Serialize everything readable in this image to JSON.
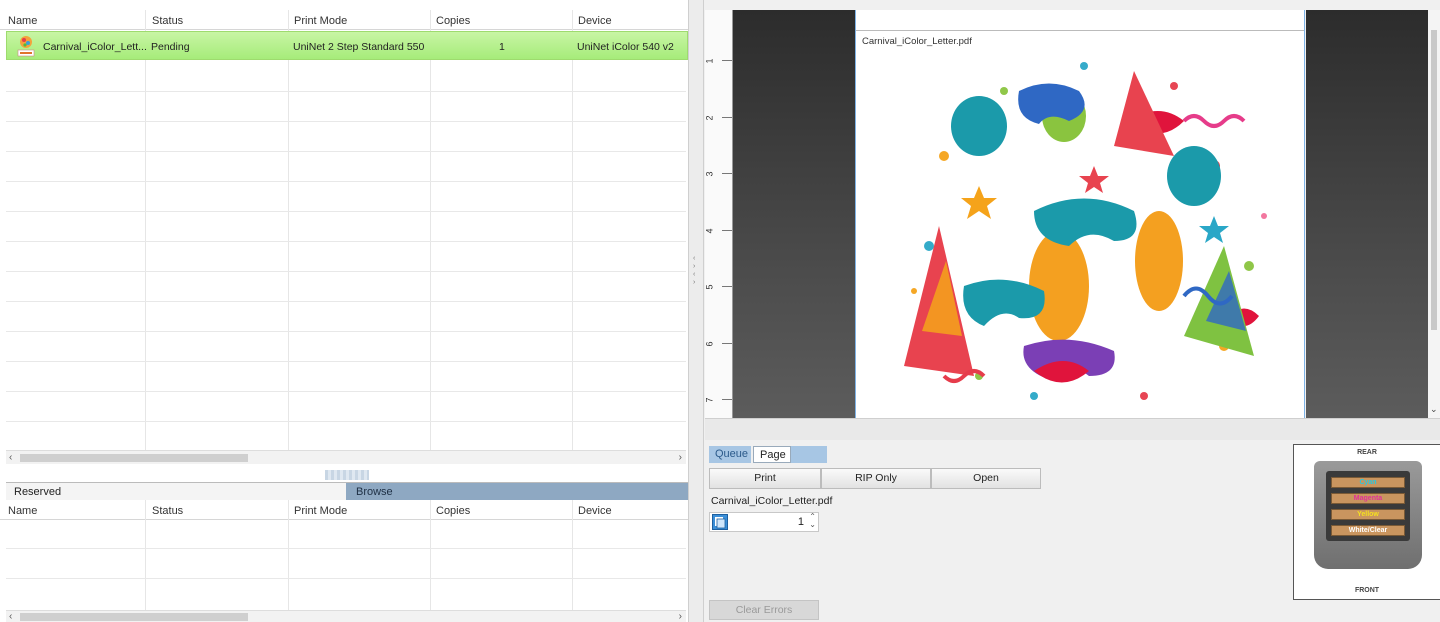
{
  "queue": {
    "columns": [
      "Name",
      "Status",
      "Print Mode",
      "Copies",
      "Device"
    ],
    "jobs": [
      {
        "name": "Carnival_iColor_Lett...",
        "status": "Pending",
        "print_mode": "UniNet 2 Step Standard 550",
        "copies": "1",
        "device": "UniNet iColor 540 v2"
      }
    ]
  },
  "lower_tabs": {
    "reserved": "Reserved",
    "browse": "Browse"
  },
  "browse": {
    "columns": [
      "Name",
      "Status",
      "Print Mode",
      "Copies",
      "Device"
    ]
  },
  "preview": {
    "page_title": "Carnival_iColor_Letter.pdf",
    "ruler_labels": [
      "1",
      "2",
      "3",
      "4",
      "5",
      "6",
      "7"
    ]
  },
  "panel": {
    "tabs": {
      "queue": "Queue",
      "page": "Page"
    },
    "buttons": {
      "print": "Print",
      "rip_only": "RIP Only",
      "open": "Open"
    },
    "filename": "Carnival_iColor_Letter.pdf",
    "copies": "1",
    "clear_errors": "Clear Errors"
  },
  "tray": {
    "rear": "REAR",
    "front": "FRONT",
    "slots": [
      "Cyan",
      "Magenta",
      "Yellow",
      "White/Clear"
    ],
    "slot_colors": [
      "#28c8e0",
      "#e0309a",
      "#f5e020",
      "#ffffff"
    ]
  },
  "colors": {
    "selected_row": "#b6f08c",
    "browse_tab": "#8ea8c2",
    "accent": "#a7c6e4"
  }
}
